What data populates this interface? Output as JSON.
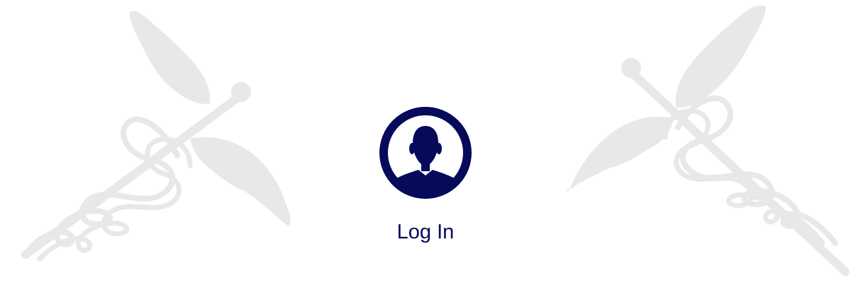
{
  "login": {
    "label": "Log In",
    "icon": "user-avatar-icon"
  },
  "decorations": {
    "left_icon": "caduceus-icon",
    "right_icon": "caduceus-icon"
  },
  "colors": {
    "brand": "#050a5a",
    "watermark": "#e8e8e8",
    "background": "#ffffff"
  }
}
